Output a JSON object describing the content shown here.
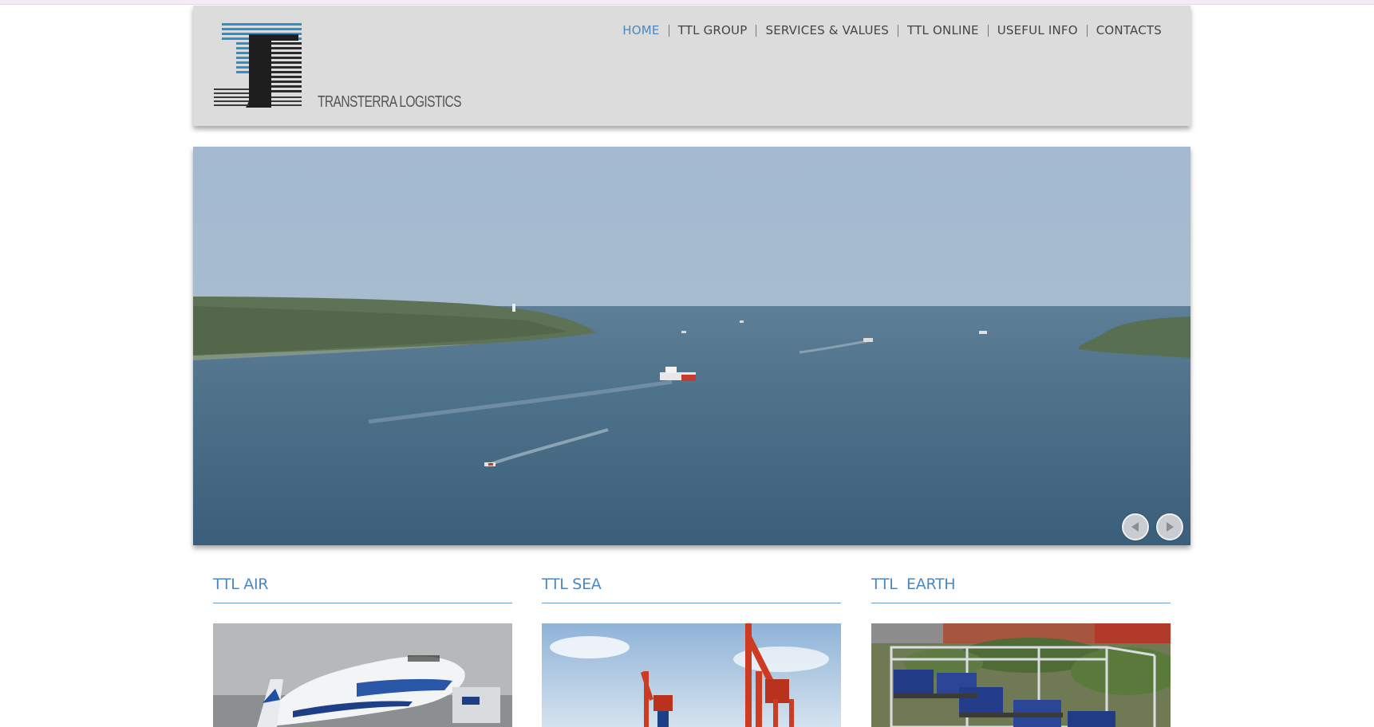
{
  "brand": {
    "name": "TRANSTERRA LOGISTICS",
    "colors": {
      "blue": "#2f8fc9",
      "dark": "#2a2a2a"
    }
  },
  "nav": {
    "items": [
      {
        "label": "HOME",
        "active": true
      },
      {
        "label": "TTL GROUP",
        "active": false
      },
      {
        "label": "SERVICES & VALUES",
        "active": false
      },
      {
        "label": "TTL ONLINE",
        "active": false
      },
      {
        "label": "USEFUL INFO",
        "active": false
      },
      {
        "label": "CONTACTS",
        "active": false
      }
    ],
    "active_color": "#4d87c0"
  },
  "slider": {
    "prev_icon": "arrow-left-icon",
    "next_icon": "arrow-right-icon"
  },
  "sections": [
    {
      "title": "TTL AIR",
      "image": "airplane-photo"
    },
    {
      "title": "TTL SEA",
      "image": "port-cranes-photo"
    },
    {
      "title": "TTL  EARTH",
      "image": "freight-train-photo"
    }
  ]
}
